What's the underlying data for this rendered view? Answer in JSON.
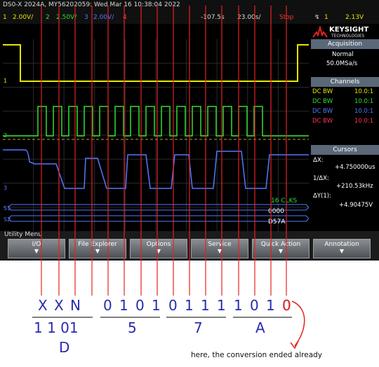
{
  "topbar": {
    "device": "DS0-X 2024A, MY56202059: Wed Mar 16 10:38:04 2022",
    "ch1_num": "1",
    "ch1_scale": "2.00V/",
    "ch2_num": "2",
    "ch2_scale": "2.50V/",
    "ch3_num": "3",
    "ch3_scale": "2.00V/",
    "ch4_num": "4",
    "time_offset": "-107.5s",
    "timebase": "23.00s/",
    "run_state": "Stop",
    "trig_src": "1",
    "trig_level": "2.13V"
  },
  "brand": {
    "name": "KEYSIGHT",
    "sub": "TECHNOLOGIES"
  },
  "panel": {
    "acq_title": "Acquisition",
    "acq_mode": "Normal",
    "acq_rate": "50.0MSa/s",
    "chan_title": "Channels",
    "channels": [
      {
        "bw": "DC BW",
        "ratio": "10.0:1",
        "color": "#e6e600"
      },
      {
        "bw": "DC BW",
        "ratio": "10.0:1",
        "color": "#33dd33"
      },
      {
        "bw": "DC BW",
        "ratio": "10.0:1",
        "color": "#5577ff"
      },
      {
        "bw": "DC BW",
        "ratio": "10.0:1",
        "color": "#ff3355"
      }
    ],
    "cur_title": "Cursors",
    "dx_label": "ΔX:",
    "dx_value": "+4.750000us",
    "inv_dx_label": "1/ΔX:",
    "inv_dx_value": "+210.53kHz",
    "dy_label": "ΔY(1):",
    "dy_value": "+4.90475V"
  },
  "screen": {
    "clks": "16 CLKS",
    "bus_a": "0000",
    "bus_b": "D57A",
    "ch_markers": [
      "1",
      "2",
      "3",
      "S1",
      "S2"
    ]
  },
  "menu": {
    "title": "Utility Menu",
    "keys": [
      "I/O",
      "File Explorer",
      "Options",
      "Service",
      "Quick Action",
      "Annotation"
    ]
  },
  "bits": {
    "labels": [
      "X",
      "X",
      "N",
      "0",
      "1",
      "0",
      "1",
      "0",
      "1",
      "1",
      "1",
      "1",
      "0",
      "1",
      "0"
    ],
    "last_bit": "0"
  },
  "groups": {
    "first": "1 1 01",
    "second": "5",
    "third": "7",
    "fourth": "A",
    "first_letter": "D"
  },
  "annotation": "here, the conversion ended already",
  "colors": {
    "bit_text": "#2a2ab0",
    "red_line": "#e52222",
    "ch1": "#e6e600",
    "ch2": "#33dd33",
    "ch3": "#5577ff"
  }
}
